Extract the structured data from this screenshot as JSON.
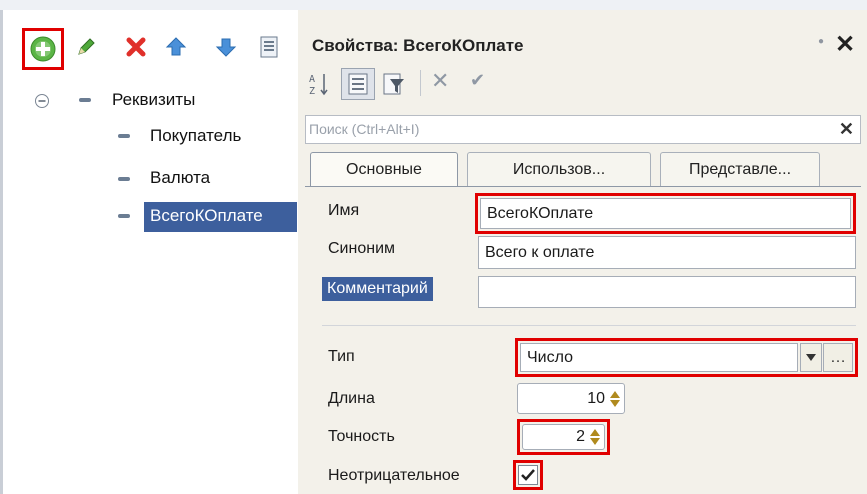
{
  "toolbar": {
    "icons": [
      "add-icon",
      "edit-icon",
      "delete-icon",
      "move-up-icon",
      "move-down-icon",
      "list-icon"
    ]
  },
  "tree": {
    "root_label": "Реквизиты",
    "items": [
      "Покупатель",
      "Валюта",
      "ВсегоКОплате"
    ],
    "selected_index": 2
  },
  "properties": {
    "title": "Свойства: ВсегоКОплате",
    "search_placeholder": "Поиск (Ctrl+Alt+I)",
    "tabs": [
      "Основные",
      "Использов...",
      "Представле..."
    ],
    "name_label": "Имя",
    "name_value": "ВсегоКОплате",
    "synonym_label": "Синоним",
    "synonym_value": "Всего к оплате",
    "comment_label": "Комментарий",
    "comment_value": "",
    "type_label": "Тип",
    "type_value": "Число",
    "length_label": "Длина",
    "length_value": "10",
    "precision_label": "Точность",
    "precision_value": "2",
    "nonnegative_label": "Неотрицательное",
    "nonnegative_checked": true
  },
  "colors": {
    "highlight": "#e00000",
    "selection": "#3d5f9d",
    "panel": "#f3f1ea"
  }
}
